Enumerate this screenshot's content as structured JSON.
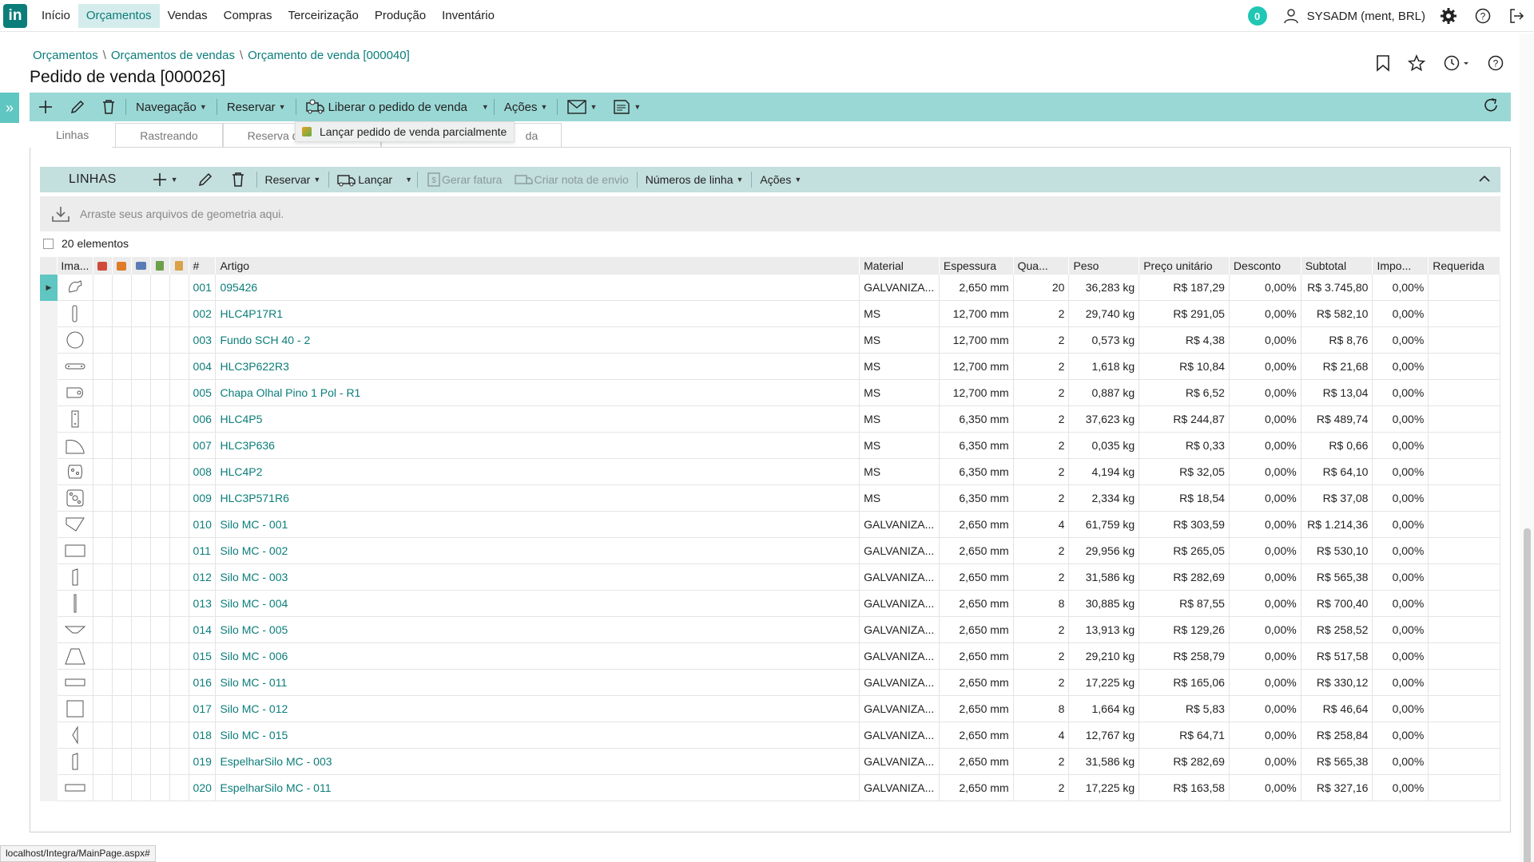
{
  "logo": "in",
  "menu": [
    "Início",
    "Orçamentos",
    "Vendas",
    "Compras",
    "Terceirização",
    "Produção",
    "Inventário"
  ],
  "notifications_count": "0",
  "user": "SYSADM (ment, BRL)",
  "breadcrumb": [
    "Orçamentos",
    "Orçamentos de vendas",
    "Orçamento de venda [000040]"
  ],
  "page_title": "Pedido de venda [000026]",
  "toolbar": {
    "navegacao": "Navegação",
    "reservar": "Reservar",
    "liberar": "Liberar o pedido de venda",
    "acoes": "Ações"
  },
  "dropdown_item": "Lançar pedido de venda parcialmente",
  "tabs": [
    "Linhas",
    "Rastreando",
    "Reserva de",
    "da"
  ],
  "lines": {
    "title": "LINHAS",
    "reservar": "Reservar",
    "lancar": "Lançar",
    "gerar_fatura": "Gerar fatura",
    "criar_nota": "Criar nota de envio",
    "numeros_linha": "Números de linha",
    "acoes": "Ações"
  },
  "dropzone_text": "Arraste seus arquivos de geometria aqui.",
  "count_label": "20 elementos",
  "columns": [
    "Ima...",
    "#",
    "Artigo",
    "Material",
    "Espessura",
    "Qua...",
    "Peso",
    "Preço unitário",
    "Desconto",
    "Subtotal",
    "Impo...",
    "Requerida"
  ],
  "rows": [
    {
      "num": "001",
      "art": "095426",
      "mat": "GALVANIZA...",
      "esp": "2,650 mm",
      "qua": "20",
      "peso": "36,283 kg",
      "preco": "R$ 187,29",
      "desc": "0,00%",
      "sub": "R$ 3.745,80",
      "imp": "0,00%",
      "shape": "hook"
    },
    {
      "num": "002",
      "art": "HLC4P17R1",
      "mat": "MS",
      "esp": "12,700 mm",
      "qua": "2",
      "peso": "29,740 kg",
      "preco": "R$ 291,05",
      "desc": "0,00%",
      "sub": "R$ 582,10",
      "imp": "0,00%",
      "shape": "tall-thin"
    },
    {
      "num": "003",
      "art": "Fundo SCH 40 - 2",
      "mat": "MS",
      "esp": "12,700 mm",
      "qua": "2",
      "peso": "0,573 kg",
      "preco": "R$ 4,38",
      "desc": "0,00%",
      "sub": "R$ 8,76",
      "imp": "0,00%",
      "shape": "circle"
    },
    {
      "num": "004",
      "art": "HLC3P622R3",
      "mat": "MS",
      "esp": "12,700 mm",
      "qua": "2",
      "peso": "1,618 kg",
      "preco": "R$ 10,84",
      "desc": "0,00%",
      "sub": "R$ 21,68",
      "imp": "0,00%",
      "shape": "slot-bar"
    },
    {
      "num": "005",
      "art": "Chapa Olhal Pino 1 Pol - R1",
      "mat": "MS",
      "esp": "12,700 mm",
      "qua": "2",
      "peso": "0,887 kg",
      "preco": "R$ 6,52",
      "desc": "0,00%",
      "sub": "R$ 13,04",
      "imp": "0,00%",
      "shape": "tag"
    },
    {
      "num": "006",
      "art": "HLC4P5",
      "mat": "MS",
      "esp": "6,350 mm",
      "qua": "2",
      "peso": "37,623 kg",
      "preco": "R$ 244,87",
      "desc": "0,00%",
      "sub": "R$ 489,74",
      "imp": "0,00%",
      "shape": "tall-rect"
    },
    {
      "num": "007",
      "art": "HLC3P636",
      "mat": "MS",
      "esp": "6,350 mm",
      "qua": "2",
      "peso": "0,035 kg",
      "preco": "R$ 0,33",
      "desc": "0,00%",
      "sub": "R$ 0,66",
      "imp": "0,00%",
      "shape": "arch"
    },
    {
      "num": "008",
      "art": "HLC4P2",
      "mat": "MS",
      "esp": "6,350 mm",
      "qua": "2",
      "peso": "4,194 kg",
      "preco": "R$ 32,05",
      "desc": "0,00%",
      "sub": "R$ 64,10",
      "imp": "0,00%",
      "shape": "blob"
    },
    {
      "num": "009",
      "art": "HLC3P571R6",
      "mat": "MS",
      "esp": "6,350 mm",
      "qua": "2",
      "peso": "2,334 kg",
      "preco": "R$ 18,54",
      "desc": "0,00%",
      "sub": "R$ 37,08",
      "imp": "0,00%",
      "shape": "square-holes"
    },
    {
      "num": "010",
      "art": "Silo MC - 001",
      "mat": "GALVANIZA...",
      "esp": "2,650 mm",
      "qua": "4",
      "peso": "61,759 kg",
      "preco": "R$ 303,59",
      "desc": "0,00%",
      "sub": "R$ 1.214,36",
      "imp": "0,00%",
      "shape": "pentagon"
    },
    {
      "num": "011",
      "art": "Silo MC - 002",
      "mat": "GALVANIZA...",
      "esp": "2,650 mm",
      "qua": "2",
      "peso": "29,956 kg",
      "preco": "R$ 265,05",
      "desc": "0,00%",
      "sub": "R$ 530,10",
      "imp": "0,00%",
      "shape": "wide-rect"
    },
    {
      "num": "012",
      "art": "Silo MC - 003",
      "mat": "GALVANIZA...",
      "esp": "2,650 mm",
      "qua": "2",
      "peso": "31,586 kg",
      "preco": "R$ 282,69",
      "desc": "0,00%",
      "sub": "R$ 565,38",
      "imp": "0,00%",
      "shape": "slant"
    },
    {
      "num": "013",
      "art": "Silo MC - 004",
      "mat": "GALVANIZA...",
      "esp": "2,650 mm",
      "qua": "8",
      "peso": "30,885 kg",
      "preco": "R$ 87,55",
      "desc": "0,00%",
      "sub": "R$ 700,40",
      "imp": "0,00%",
      "shape": "line"
    },
    {
      "num": "014",
      "art": "Silo MC - 005",
      "mat": "GALVANIZA...",
      "esp": "2,650 mm",
      "qua": "2",
      "peso": "13,913 kg",
      "preco": "R$ 129,26",
      "desc": "0,00%",
      "sub": "R$ 258,52",
      "imp": "0,00%",
      "shape": "inv-trap"
    },
    {
      "num": "015",
      "art": "Silo MC - 006",
      "mat": "GALVANIZA...",
      "esp": "2,650 mm",
      "qua": "2",
      "peso": "29,210 kg",
      "preco": "R$ 258,79",
      "desc": "0,00%",
      "sub": "R$ 517,58",
      "imp": "0,00%",
      "shape": "trapezoid"
    },
    {
      "num": "016",
      "art": "Silo MC - 011",
      "mat": "GALVANIZA...",
      "esp": "2,650 mm",
      "qua": "2",
      "peso": "17,225 kg",
      "preco": "R$ 165,06",
      "desc": "0,00%",
      "sub": "R$ 330,12",
      "imp": "0,00%",
      "shape": "flat-rect"
    },
    {
      "num": "017",
      "art": "Silo MC - 012",
      "mat": "GALVANIZA...",
      "esp": "2,650 mm",
      "qua": "8",
      "peso": "1,664 kg",
      "preco": "R$ 5,83",
      "desc": "0,00%",
      "sub": "R$ 46,64",
      "imp": "0,00%",
      "shape": "square"
    },
    {
      "num": "018",
      "art": "Silo MC - 015",
      "mat": "GALVANIZA...",
      "esp": "2,650 mm",
      "qua": "4",
      "peso": "12,767 kg",
      "preco": "R$ 64,71",
      "desc": "0,00%",
      "sub": "R$ 258,84",
      "imp": "0,00%",
      "shape": "left-tri"
    },
    {
      "num": "019",
      "art": "EspelharSilo MC - 003",
      "mat": "GALVANIZA...",
      "esp": "2,650 mm",
      "qua": "2",
      "peso": "31,586 kg",
      "preco": "R$ 282,69",
      "desc": "0,00%",
      "sub": "R$ 565,38",
      "imp": "0,00%",
      "shape": "slant"
    },
    {
      "num": "020",
      "art": "EspelharSilo MC - 011",
      "mat": "GALVANIZA...",
      "esp": "2,650 mm",
      "qua": "2",
      "peso": "17,225 kg",
      "preco": "R$ 163,58",
      "desc": "0,00%",
      "sub": "R$ 327,16",
      "imp": "0,00%",
      "shape": "flat-rect"
    }
  ],
  "status_url": "localhost/Integra/MainPage.aspx#",
  "colors": {
    "accent": "#0b7d7a",
    "toolbar": "#9ad8d5",
    "lines_toolbar": "#c3dfde",
    "badge": "#1fc7b4"
  }
}
